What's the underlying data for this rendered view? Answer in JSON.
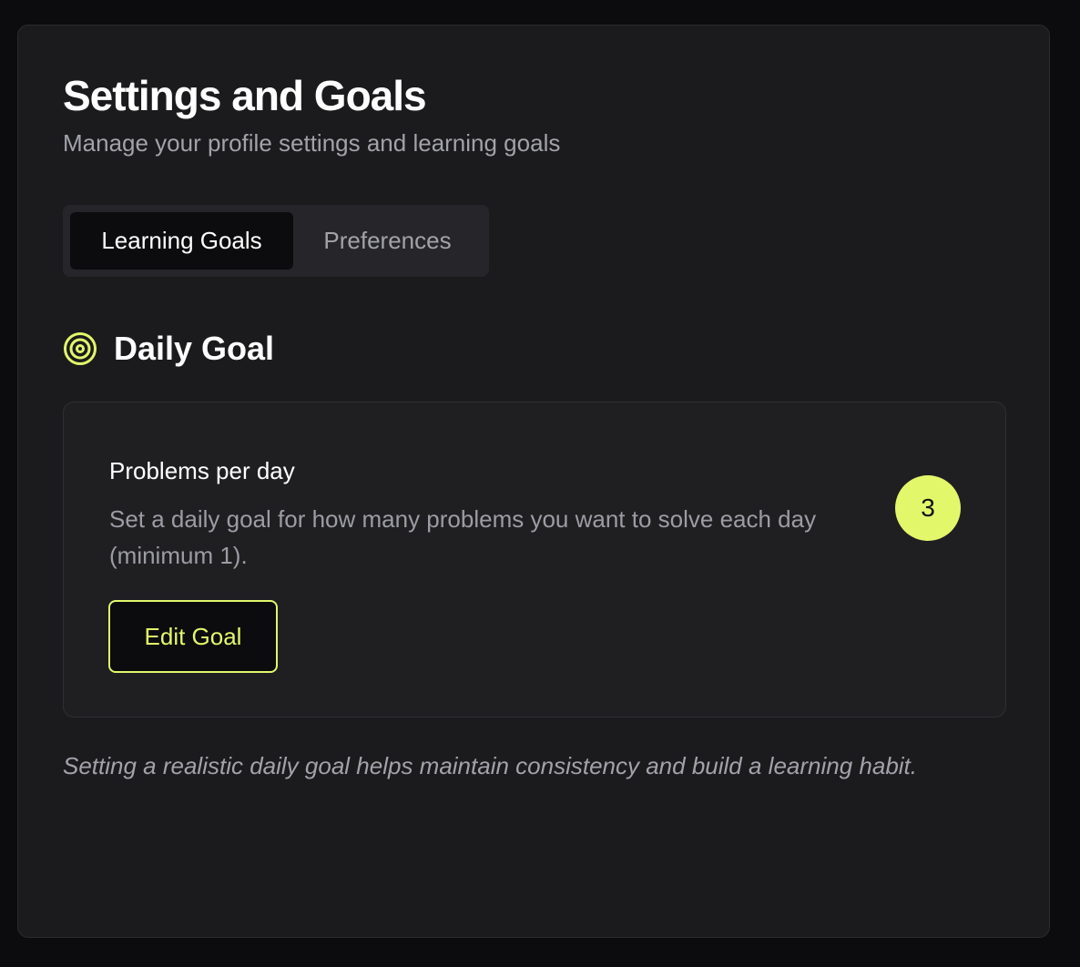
{
  "header": {
    "title": "Settings and Goals",
    "subtitle": "Manage your profile settings and learning goals"
  },
  "tabs": [
    {
      "label": "Learning Goals",
      "active": true
    },
    {
      "label": "Preferences",
      "active": false
    }
  ],
  "section": {
    "icon": "target-icon",
    "title": "Daily Goal"
  },
  "goal_card": {
    "label": "Problems per day",
    "description": "Set a daily goal for how many problems you want to solve each day (minimum 1).",
    "value": "3",
    "edit_label": "Edit Goal"
  },
  "note": "Setting a realistic daily goal helps maintain consistency and build a learning habit.",
  "colors": {
    "background": "#0c0c0e",
    "panel": "#1b1b1d",
    "card": "#1f1f22",
    "accent": "#e3f76b",
    "muted_text": "#a2a2aa"
  }
}
